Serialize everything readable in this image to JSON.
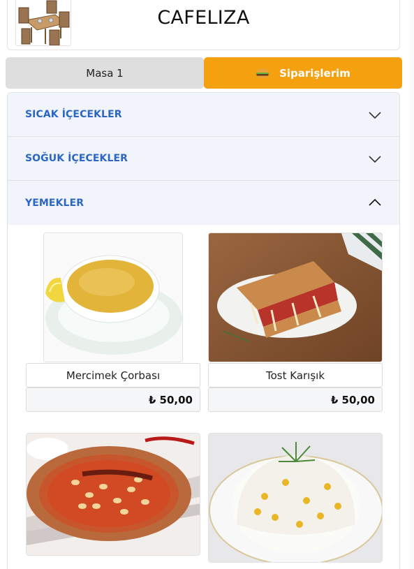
{
  "header": {
    "brand": "CAFELIZA",
    "logo_icon": "cafe-tables-logo"
  },
  "tabs": {
    "table_label": "Masa 1",
    "orders_label": "Siparişlerim",
    "orders_icon": "burger-icon"
  },
  "colors": {
    "accent_orange": "#f5a00f",
    "category_blue": "#2b66c4",
    "accordion_bg": "#f1f5fb",
    "tab_grey": "#dedede"
  },
  "categories": [
    {
      "label": "SICAK İÇECEKLER",
      "expanded": false
    },
    {
      "label": "SOĞUK İÇECEKLER",
      "expanded": false
    },
    {
      "label": "YEMEKLER",
      "expanded": true
    }
  ],
  "products": [
    {
      "name": "Mercimek Çorbası",
      "price": "₺ 50,00",
      "image": "lentil-soup"
    },
    {
      "name": "Tost Karışık",
      "price": "₺ 50,00",
      "image": "mixed-toast"
    },
    {
      "name": "",
      "price": "",
      "image": "bean-stew"
    },
    {
      "name": "",
      "price": "",
      "image": "rice-pilaf"
    }
  ]
}
